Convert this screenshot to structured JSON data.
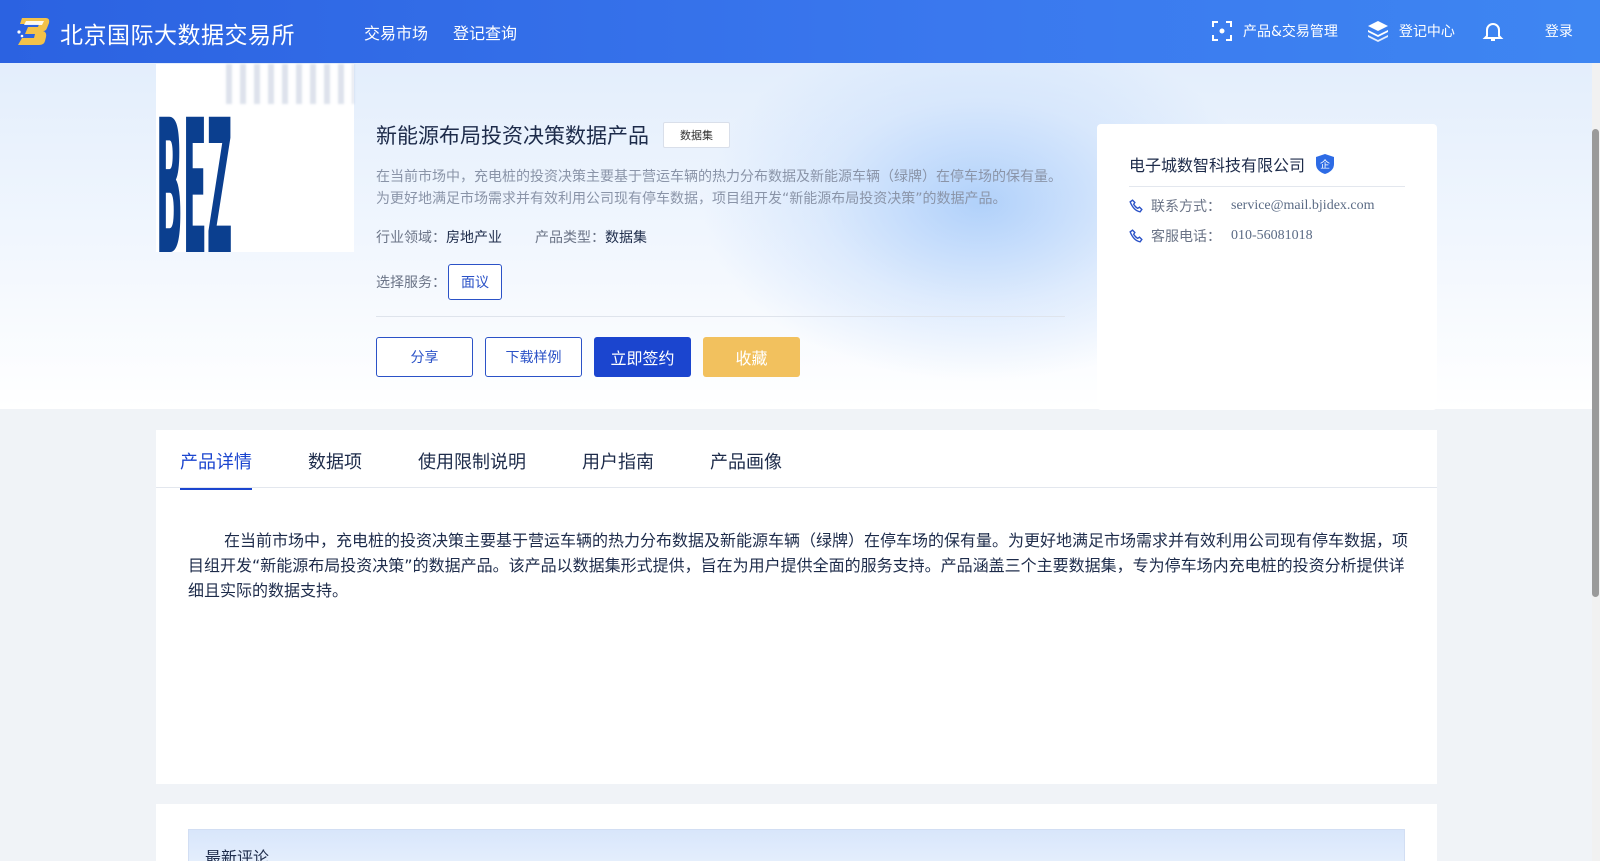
{
  "header": {
    "site_title": "北京国际大数据交易所",
    "nav": [
      "交易市场",
      "登记查询"
    ],
    "product_trade_mgmt": "产品&交易管理",
    "registry_center": "登记中心",
    "login": "登录"
  },
  "product": {
    "title": "新能源布局投资决策数据产品",
    "tag": "数据集",
    "description": "在当前市场中，充电桩的投资决策主要基于营运车辆的热力分布数据及新能源车辆（绿牌）在停车场的保有量。为更好地满足市场需求并有效利用公司现有停车数据，项目组开发“新能源布局投资决策”的数据产品。",
    "industry_label": "行业领域：",
    "industry_value": "房地产业",
    "type_label": "产品类型：",
    "type_value": "数据集",
    "service_label": "选择服务：",
    "service_option": "面议",
    "image_text": "BEZ"
  },
  "actions": {
    "share": "分享",
    "download_sample": "下载样例",
    "sign_now": "立即签约",
    "favorite": "收藏"
  },
  "company": {
    "name": "电子城数智科技有限公司",
    "badge": "企",
    "contact_label": "联系方式：",
    "contact_value": "service@mail.bjidex.com",
    "phone_label": "客服电话：",
    "phone_value": "010-56081018"
  },
  "tabs": [
    "产品详情",
    "数据项",
    "使用限制说明",
    "用户指南",
    "产品画像"
  ],
  "active_tab": "产品详情",
  "detail_text": "在当前市场中，充电桩的投资决策主要基于营运车辆的热力分布数据及新能源车辆（绿牌）在停车场的保有量。为更好地满足市场需求并有效利用公司现有停车数据，项目组开发“新能源布局投资决策”的数据产品。该产品以数据集形式提供，旨在为用户提供全面的服务支持。产品涵盖三个主要数据集，专为停车场内充电桩的投资分析提供详细且实际的数据支持。",
  "comments": {
    "title": "最新评论"
  },
  "colors": {
    "header_blue": "#2b62e1",
    "primary": "#1b45cf",
    "favorite_yellow": "#f2c15e"
  }
}
